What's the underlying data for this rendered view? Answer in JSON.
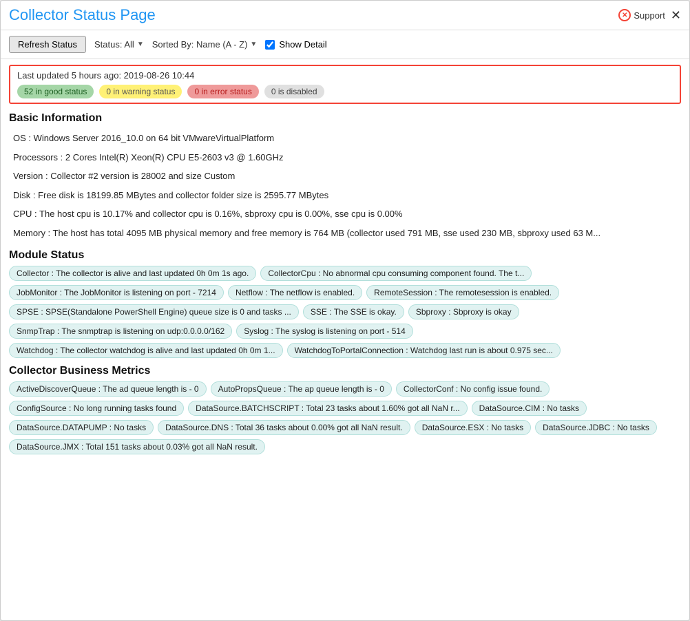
{
  "window": {
    "title": "Collector Status Page",
    "support_label": "Support",
    "close_label": "✕"
  },
  "toolbar": {
    "refresh_label": "Refresh Status",
    "status_label": "Status: All",
    "sorted_by_label": "Sorted By: Name (A - Z)",
    "show_detail_label": "Show Detail"
  },
  "status_summary": {
    "last_updated": "Last updated 5 hours ago: 2019-08-26 10:44",
    "badges": [
      {
        "text": "52 in good status",
        "type": "green"
      },
      {
        "text": "0 in warning status",
        "type": "yellow"
      },
      {
        "text": "0 in error status",
        "type": "red"
      },
      {
        "text": "0 is disabled",
        "type": "gray"
      }
    ]
  },
  "basic_info": {
    "title": "Basic Information",
    "items": [
      "OS : Windows Server 2016_10.0 on 64 bit VMwareVirtualPlatform",
      "Processors : 2 Cores Intel(R) Xeon(R) CPU E5-2603 v3 @ 1.60GHz",
      "Version : Collector #2 version is 28002 and size Custom",
      "Disk : Free disk is 18199.85 MBytes and collector folder size is 2595.77 MBytes",
      "CPU : The host cpu is 10.17% and collector cpu is 0.16%, sbproxy cpu is 0.00%, sse cpu is 0.00%",
      "Memory : The host has total 4095 MB physical memory and free memory is 764 MB (collector used 791 MB, sse used 230 MB, sbproxy used 63 M..."
    ]
  },
  "module_status": {
    "title": "Module Status",
    "tags": [
      "Collector : The collector is alive and last updated 0h 0m 1s ago.",
      "CollectorCpu : No abnormal cpu consuming component found. The t...",
      "JobMonitor : The JobMonitor is listening on port - 7214",
      "Netflow : The netflow is enabled.",
      "RemoteSession : The remotesession is enabled.",
      "SPSE : SPSE(Standalone PowerShell Engine) queue size is 0 and tasks ...",
      "SSE : The SSE is okay.",
      "Sbproxy : Sbproxy is okay",
      "SnmpTrap : The snmptrap is listening on udp:0.0.0.0/162",
      "Syslog : The syslog is listening on port - 514",
      "Watchdog : The collector watchdog is alive and last updated 0h 0m 1...",
      "WatchdogToPortalConnection : Watchdog last run is about 0.975 sec..."
    ]
  },
  "business_metrics": {
    "title": "Collector Business Metrics",
    "tags": [
      "ActiveDiscoverQueue : The ad queue length is - 0",
      "AutoPropsQueue : The ap queue length is - 0",
      "CollectorConf : No config issue found.",
      "ConfigSource : No long running tasks found",
      "DataSource.BATCHSCRIPT : Total 23 tasks about 1.60% got all NaN r...",
      "DataSource.CIM : No tasks",
      "DataSource.DATAPUMP : No tasks",
      "DataSource.DNS : Total 36 tasks about 0.00% got all NaN result.",
      "DataSource.ESX : No tasks",
      "DataSource.JDBC : No tasks",
      "DataSource.JMX : Total 151 tasks about 0.03% got all NaN result."
    ]
  }
}
